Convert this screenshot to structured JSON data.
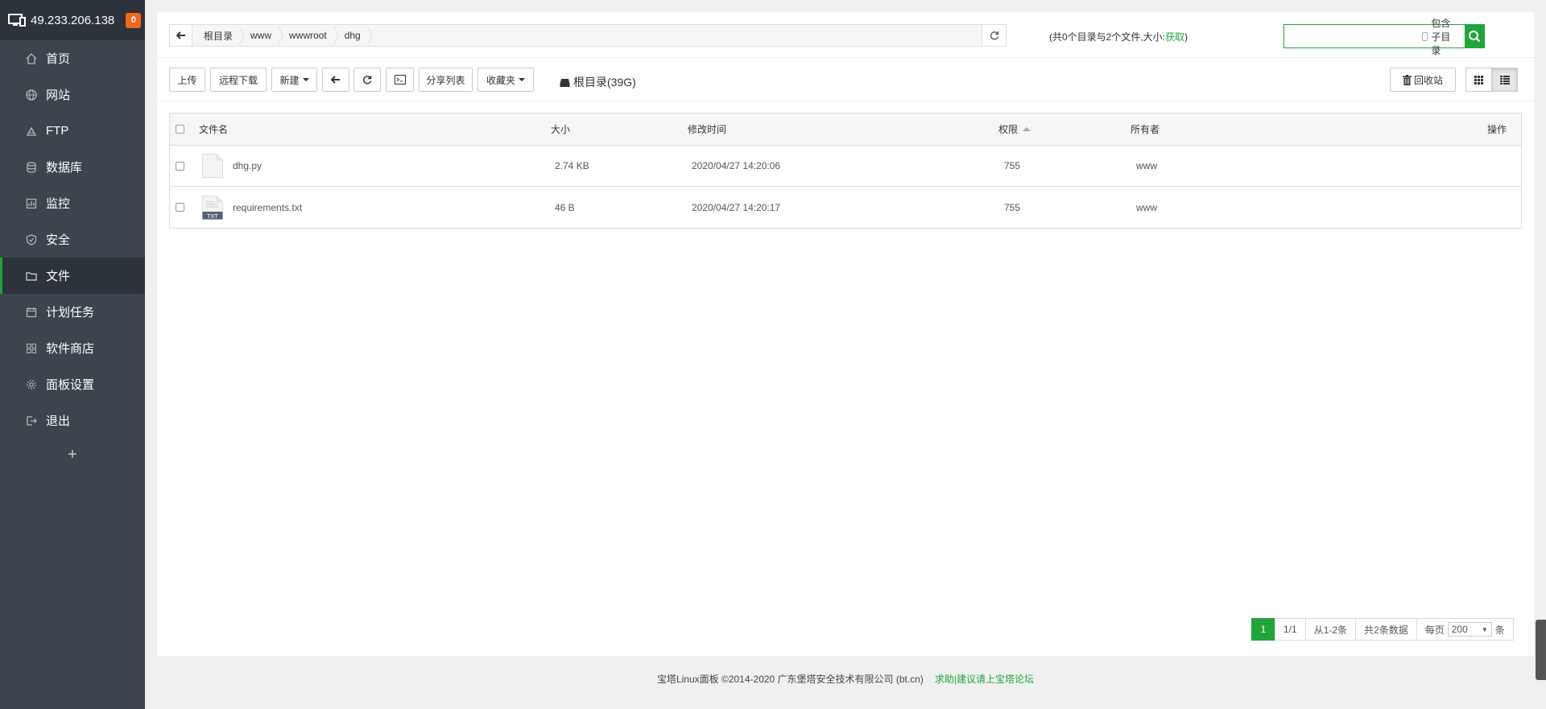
{
  "sidebar": {
    "host": "49.233.206.138",
    "badge": "0",
    "items": [
      {
        "label": "首页",
        "icon": "home-icon"
      },
      {
        "label": "网站",
        "icon": "globe-icon"
      },
      {
        "label": "FTP",
        "icon": "ftp-icon"
      },
      {
        "label": "数据库",
        "icon": "database-icon"
      },
      {
        "label": "监控",
        "icon": "monitor-icon"
      },
      {
        "label": "安全",
        "icon": "shield-icon"
      },
      {
        "label": "文件",
        "icon": "folder-icon",
        "active": true
      },
      {
        "label": "计划任务",
        "icon": "calendar-icon"
      },
      {
        "label": "软件商店",
        "icon": "apps-icon"
      },
      {
        "label": "面板设置",
        "icon": "gear-icon"
      },
      {
        "label": "退出",
        "icon": "logout-icon"
      }
    ],
    "add_label": "+"
  },
  "path": {
    "crumbs": [
      "根目录",
      "www",
      "wwwroot",
      "dhg"
    ],
    "info_prefix": "(共0个目录与2个文件,大小:",
    "info_link": "获取",
    "info_suffix": ")"
  },
  "search": {
    "placeholder": "",
    "include_sub_label": "包含子目录"
  },
  "toolbar": {
    "upload": "上传",
    "remote_download": "远程下载",
    "new": "新建",
    "share_list": "分享列表",
    "favorites": "收藏夹",
    "disk_label": "根目录(39G)",
    "recycle": "回收站"
  },
  "table": {
    "headers": {
      "name": "文件名",
      "size": "大小",
      "mtime": "修改时间",
      "perm": "权限",
      "owner": "所有者",
      "ops": "操作"
    },
    "rows": [
      {
        "name": "dhg.py",
        "size": "2.74 KB",
        "mtime": "2020/04/27 14:20:06",
        "perm": "755",
        "owner": "www",
        "icon": "file-icon"
      },
      {
        "name": "requirements.txt",
        "size": "46 B",
        "mtime": "2020/04/27 14:20:17",
        "perm": "755",
        "owner": "www",
        "icon": "txt-file-icon"
      }
    ]
  },
  "pager": {
    "current": "1",
    "pages": "1/1",
    "range": "从1-2条",
    "total": "共2条数据",
    "per_page_label": "每页",
    "per_page_value": "200",
    "unit": "条"
  },
  "footer": {
    "copyright": "宝塔Linux面板 ©2014-2020 广东堡塔安全技术有限公司 (bt.cn)",
    "help_link": "求助|建议请上宝塔论坛"
  },
  "colors": {
    "accent": "#20a53a",
    "sidebar_bg": "#3c444d",
    "sidebar_header_bg": "#2c333b",
    "badge": "#f0671a"
  }
}
